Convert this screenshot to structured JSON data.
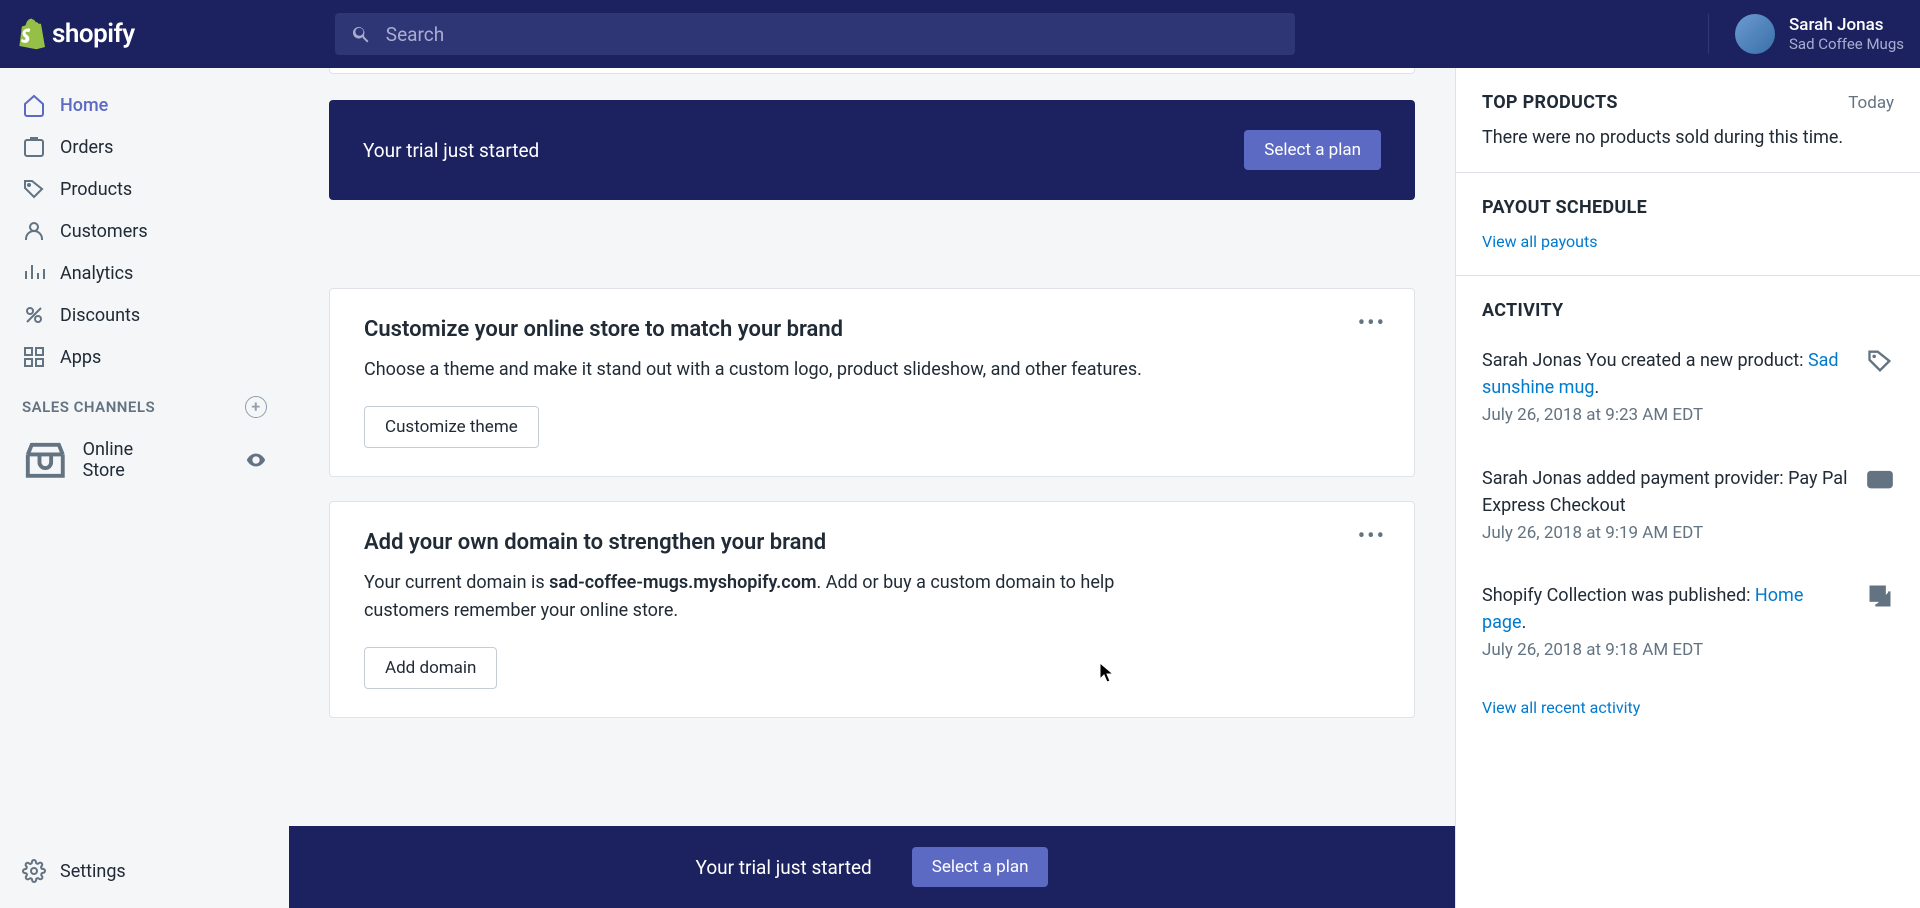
{
  "brand": "shopify",
  "search_placeholder": "Search",
  "profile": {
    "name": "Sarah Jonas",
    "store": "Sad Coffee Mugs"
  },
  "nav": {
    "home": "Home",
    "orders": "Orders",
    "products": "Products",
    "customers": "Customers",
    "analytics": "Analytics",
    "discounts": "Discounts",
    "apps": "Apps",
    "sales_channels": "SALES CHANNELS",
    "online_store": "Online Store",
    "settings": "Settings"
  },
  "trial": {
    "message": "Your trial just started",
    "cta": "Select a plan"
  },
  "card_customize": {
    "title": "Customize your online store to match your brand",
    "body": "Choose a theme and make it stand out with a custom logo, product slideshow, and other features.",
    "button": "Customize theme"
  },
  "card_domain": {
    "title": "Add your own domain to strengthen your brand",
    "body_pre": "Your current domain is ",
    "domain": "sad-coffee-mugs.myshopify.com",
    "body_post": ". Add or buy a custom domain to help customers remember your online store.",
    "button": "Add domain"
  },
  "top_products": {
    "title": "TOP PRODUCTS",
    "meta": "Today",
    "empty": "There were no products sold during this time."
  },
  "payout": {
    "title": "PAYOUT SCHEDULE",
    "link": "View all payouts"
  },
  "activity": {
    "title": "ACTIVITY",
    "items": [
      {
        "prefix": "Sarah Jonas You created a new product: ",
        "link": "Sad sunshine mug",
        "suffix": ".",
        "time": "July 26, 2018 at 9:23 AM EDT"
      },
      {
        "prefix": "Sarah Jonas added payment provider: Pay Pal Express Checkout",
        "link": "",
        "suffix": "",
        "time": "July 26, 2018 at 9:19 AM EDT"
      },
      {
        "prefix": "Shopify Collection was published: ",
        "link": "Home page",
        "suffix": ".",
        "time": "July 26, 2018 at 9:18 AM EDT"
      }
    ],
    "view_all": "View all recent activity"
  }
}
